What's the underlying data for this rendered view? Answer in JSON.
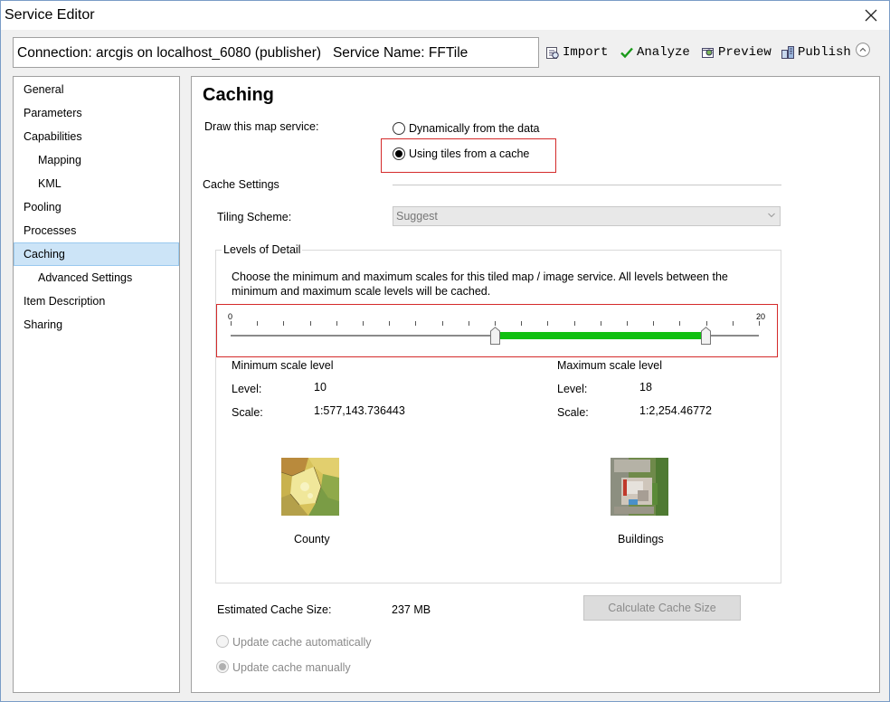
{
  "window": {
    "title": "Service Editor"
  },
  "header": {
    "connection": "Connection: arcgis on localhost_6080 (publisher)",
    "service_name": "Service Name: FFTile"
  },
  "toolbar": {
    "import_label": "Import",
    "analyze_label": "Analyze",
    "preview_label": "Preview",
    "publish_label": "Publish"
  },
  "sidebar": {
    "items": [
      {
        "label": "General"
      },
      {
        "label": "Parameters"
      },
      {
        "label": "Capabilities"
      },
      {
        "label": "Mapping"
      },
      {
        "label": "KML"
      },
      {
        "label": "Pooling"
      },
      {
        "label": "Processes"
      },
      {
        "label": "Caching"
      },
      {
        "label": "Advanced Settings"
      },
      {
        "label": "Item Description"
      },
      {
        "label": "Sharing"
      }
    ],
    "selected": "Caching"
  },
  "main": {
    "title": "Caching",
    "draw_label": "Draw this map service:",
    "draw_options": [
      "Dynamically from the data",
      "Using tiles from a cache"
    ],
    "draw_selected": "Using tiles from a cache",
    "cache_settings_label": "Cache Settings",
    "tiling_scheme_label": "Tiling Scheme:",
    "tiling_scheme_value": "Suggest",
    "lod_title": "Levels of Detail",
    "lod_description_1": "Choose the minimum and maximum scales for this tiled map / image service. All levels between the",
    "lod_description_2": "minimum and maximum scale levels will be cached.",
    "slider": {
      "min": "0",
      "max": "20",
      "low": 10,
      "high": 18,
      "range_color": "#11c011"
    },
    "min_scale": {
      "heading": "Minimum scale level",
      "level_label": "Level:",
      "level_value": "10",
      "scale_label": "Scale:",
      "scale_value": "1:577,143.736443",
      "thumbnail_caption": "County"
    },
    "max_scale": {
      "heading": "Maximum scale level",
      "level_label": "Level:",
      "level_value": "18",
      "scale_label": "Scale:",
      "scale_value": "1:2,254.46772",
      "thumbnail_caption": "Buildings"
    },
    "estimated_cache_label": "Estimated Cache Size:",
    "estimated_cache_value": "237 MB",
    "calculate_button": "Calculate Cache Size",
    "update_options": [
      "Update cache automatically",
      "Update cache manually"
    ],
    "update_selected": "Update cache manually"
  },
  "colors": {
    "highlight": "#d42a2a",
    "selection": "#cce4f7",
    "slider_range": "#11c011"
  }
}
